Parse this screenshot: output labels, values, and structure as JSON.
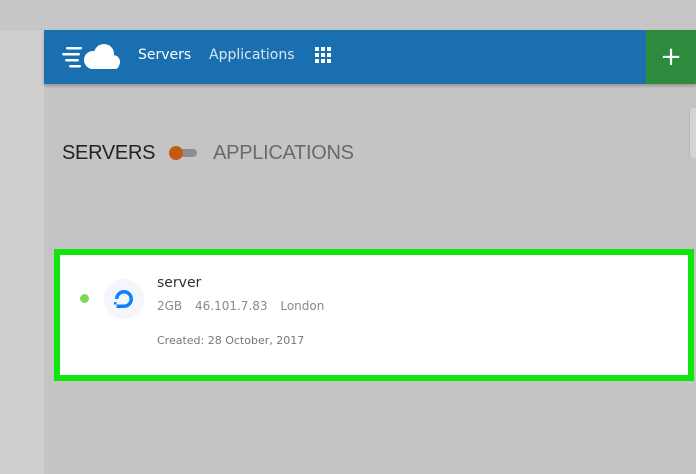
{
  "navbar": {
    "brand": "cloud-logo-icon",
    "links": [
      {
        "label": "Servers"
      },
      {
        "label": "Applications"
      }
    ],
    "apps_icon": "grid-icon",
    "add_label": "+",
    "color": "#1a6fb0",
    "add_color": "#2e8b3e"
  },
  "toggle": {
    "left_label": "SERVERS",
    "right_label": "APPLICATIONS",
    "knob_color": "#c5590f"
  },
  "server": {
    "name": "server",
    "size": "2GB",
    "ip": "46.101.7.83",
    "location": "London",
    "created": "Created: 28 October, 2017",
    "status_color": "#7ed957",
    "provider_icon": "digitalocean-icon",
    "highlight_color": "#12e50e"
  }
}
